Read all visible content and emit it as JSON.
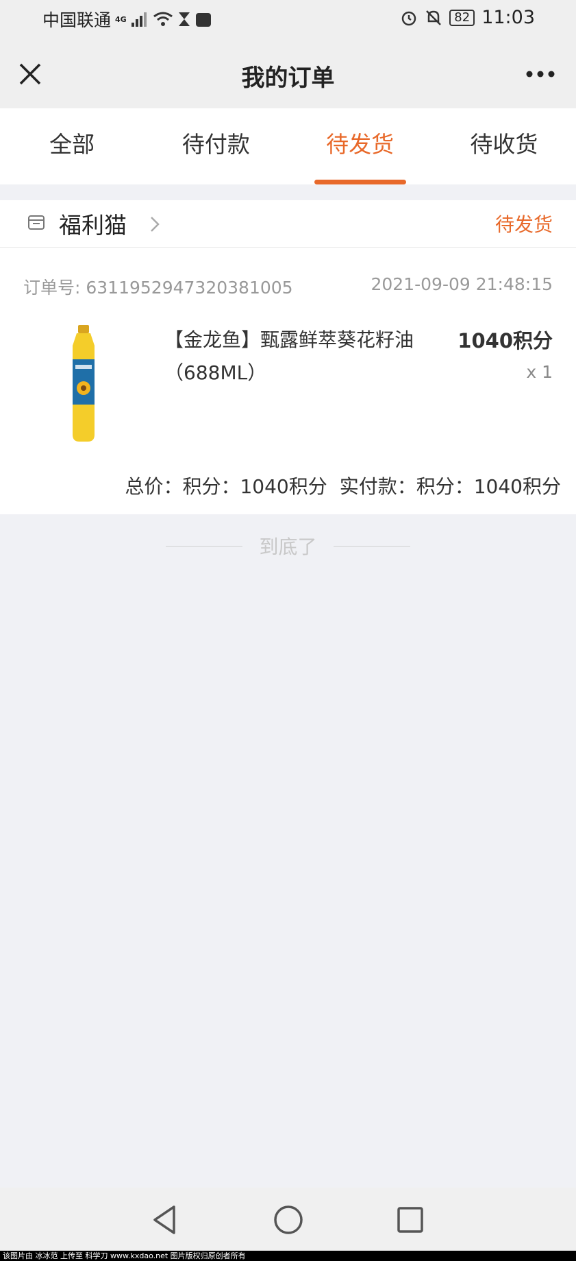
{
  "status_bar": {
    "carrier": "中国联通",
    "network": "4G",
    "battery": "82",
    "time": "11:03"
  },
  "nav": {
    "title": "我的订单",
    "close_icon": "close-icon",
    "more_icon": "more-icon"
  },
  "tabs": [
    {
      "label": "全部"
    },
    {
      "label": "待付款"
    },
    {
      "label": "待发货"
    },
    {
      "label": "待收货"
    }
  ],
  "active_tab": "待发货",
  "order": {
    "shop_name": "福利猫",
    "status": "待发货",
    "order_no": "订单号: 6311952947320381005",
    "datetime": "2021-09-09 21:48:15",
    "product": {
      "name": "【金龙鱼】甄露鲜萃葵花籽油（688ML）",
      "price": "1040积分",
      "quantity": "x 1"
    },
    "total_label": "总价：积分：1040积分",
    "paid_label": "实付款：积分：1040积分"
  },
  "end_text": "到底了",
  "watermark": "该图片由 冰冰范 上传至 科学刀 www.kxdao.net 图片版权归原创者所有",
  "colors": {
    "accent": "#e8692a",
    "background": "#f0f1f5"
  }
}
